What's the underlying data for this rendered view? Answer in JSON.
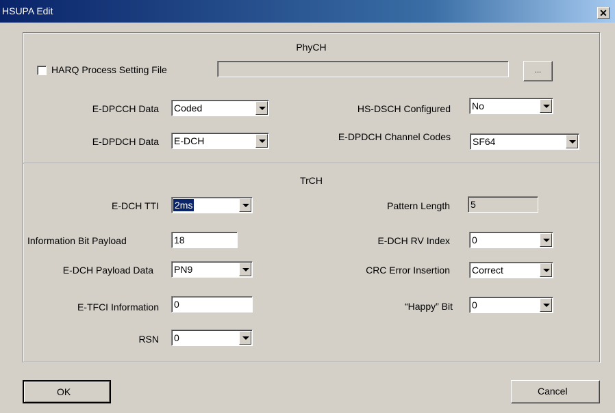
{
  "window": {
    "title": "HSUPA Edit"
  },
  "phych": {
    "title": "PhyCH",
    "harq_label": "HARQ Process Setting File",
    "harq_checked": false,
    "harq_path": "",
    "browse_label": "...",
    "edpcch_label": "E-DPCCH Data",
    "edpcch_value": "Coded",
    "edpdch_label": "E-DPDCH Data",
    "edpdch_value": "E-DCH",
    "hsdsch_label": "HS-DSCH Configured",
    "hsdsch_value": "No",
    "codes_label": "E-DPDCH Channel Codes",
    "codes_value": "SF64"
  },
  "trch": {
    "title": "TrCH",
    "tti_label": "E-DCH TTI",
    "tti_value": "2ms",
    "info_label": "Information Bit Payload",
    "info_value": "18",
    "payload_label": "E-DCH Payload Data",
    "payload_value": "PN9",
    "etfci_label": "E-TFCI Information",
    "etfci_value": "0",
    "rsn_label": "RSN",
    "rsn_value": "0",
    "pattern_label": "Pattern Length",
    "pattern_value": "5",
    "rv_label": "E-DCH RV Index",
    "rv_value": "0",
    "crc_label": "CRC Error Insertion",
    "crc_value": "Correct",
    "happy_label": "“Happy” Bit",
    "happy_value": "0"
  },
  "buttons": {
    "ok": "OK",
    "cancel": "Cancel"
  }
}
